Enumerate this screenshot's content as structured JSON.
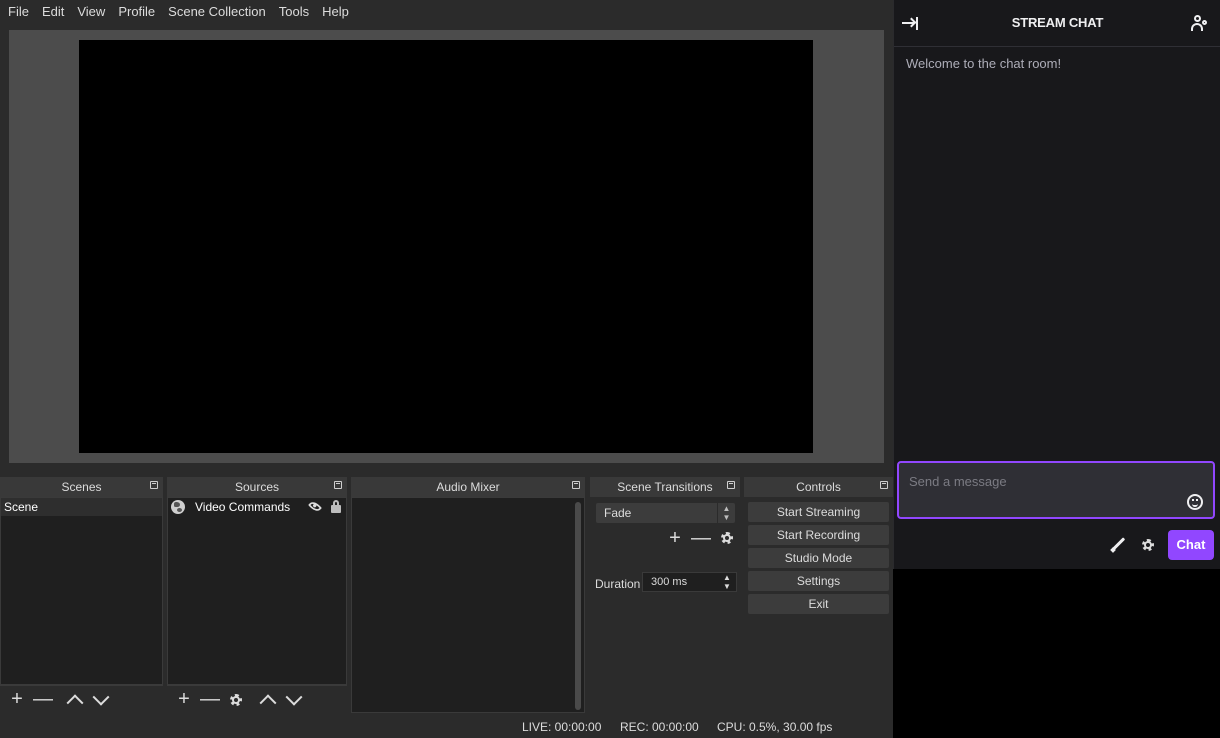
{
  "menubar": {
    "items": [
      "File",
      "Edit",
      "View",
      "Profile",
      "Scene Collection",
      "Tools",
      "Help"
    ]
  },
  "docks": {
    "scenes": {
      "title": "Scenes",
      "items": [
        "Scene"
      ]
    },
    "sources": {
      "title": "Sources",
      "items": [
        {
          "name": "Video Commands",
          "icon": "globe-icon",
          "visible": true,
          "locked": false
        }
      ]
    },
    "audio_mixer": {
      "title": "Audio Mixer"
    },
    "scene_transitions": {
      "title": "Scene Transitions",
      "selected": "Fade",
      "duration_label": "Duration",
      "duration_value": "300 ms"
    },
    "controls": {
      "title": "Controls",
      "buttons": [
        "Start Streaming",
        "Start Recording",
        "Studio Mode",
        "Settings",
        "Exit"
      ]
    }
  },
  "statusbar": {
    "live": "LIVE: 00:00:00",
    "rec": "REC: 00:00:00",
    "cpu": "CPU: 0.5%, 30.00 fps"
  },
  "chat": {
    "title": "STREAM CHAT",
    "welcome": "Welcome to the chat room!",
    "input_placeholder": "Send a message",
    "send_label": "Chat",
    "accent": "#9147ff"
  }
}
